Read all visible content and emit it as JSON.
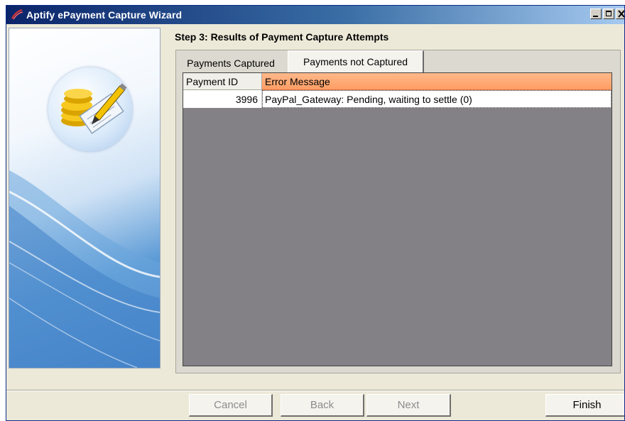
{
  "window": {
    "title": "Aptify ePayment Capture Wizard",
    "controls": [
      "minimize-icon",
      "maximize-icon",
      "close-icon"
    ]
  },
  "step": {
    "title": "Step 3: Results of Payment Capture Attempts"
  },
  "tabs": [
    {
      "label": "Payments Captured",
      "selected": false
    },
    {
      "label": "Payments not Captured",
      "selected": true
    }
  ],
  "grid": {
    "columns": [
      "Payment ID",
      "Error Message"
    ],
    "rows": [
      {
        "payment_id": "3996",
        "error_message": "PayPal_Gateway: Pending, waiting to settle (0)"
      }
    ]
  },
  "buttons": {
    "cancel": "Cancel",
    "back": "Back",
    "next": "Next",
    "finish": "Finish"
  },
  "colors": {
    "title_bar": "#0a246a",
    "header_highlight": "#ff9d64",
    "grid_background": "#838186"
  },
  "icons": {
    "side": "coins-and-check-icon",
    "title": "aptify-logo-icon"
  }
}
